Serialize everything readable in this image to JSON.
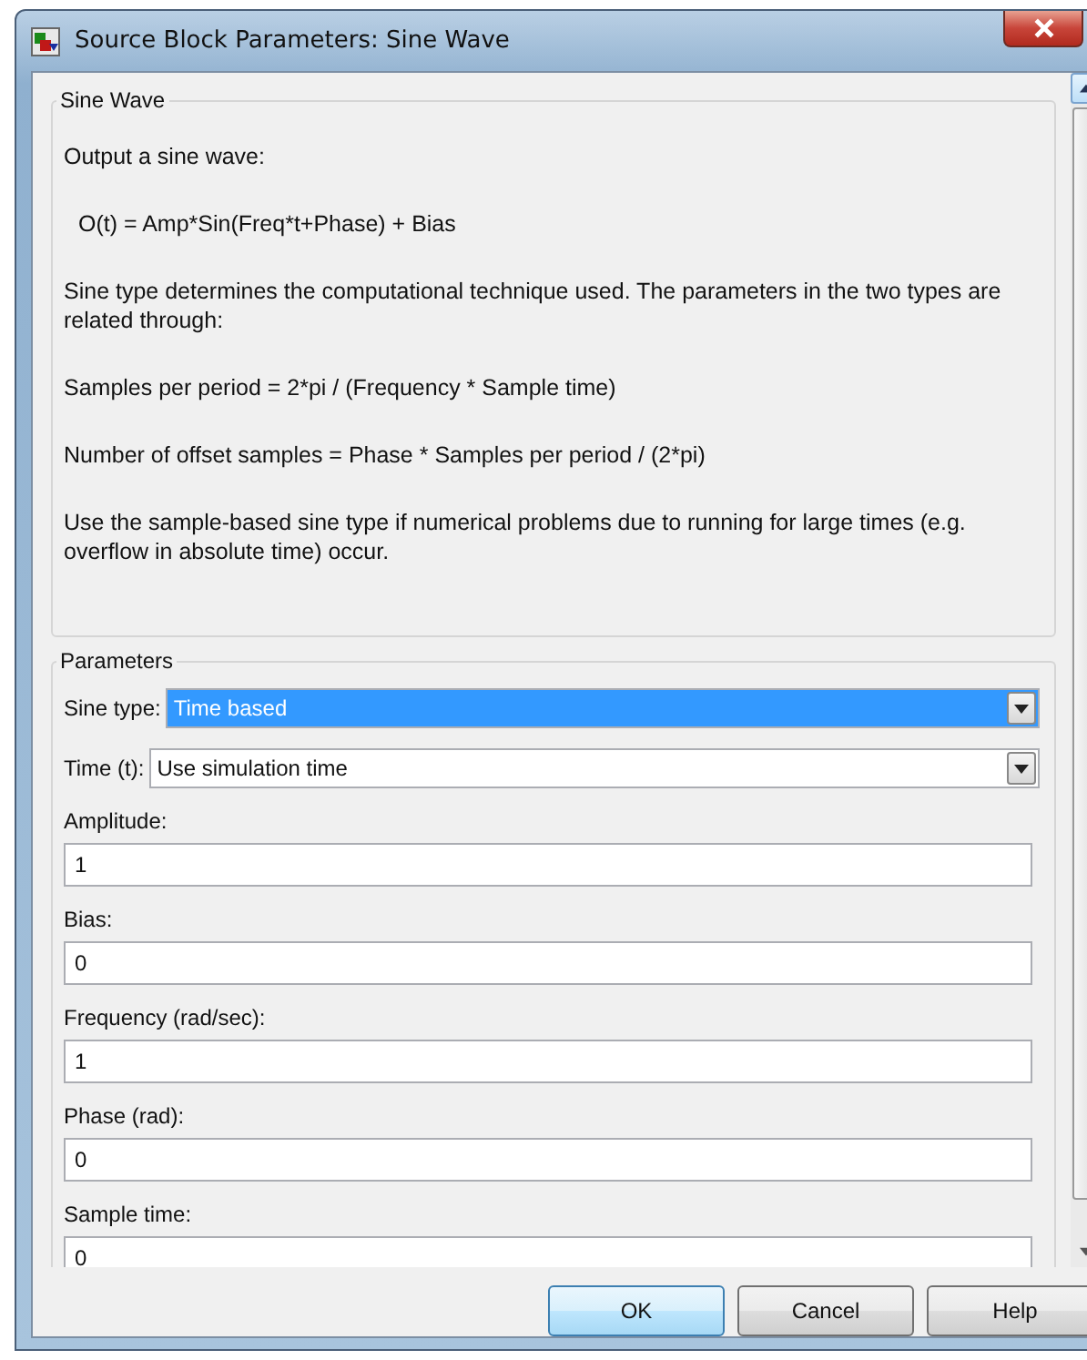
{
  "window": {
    "title": "Source Block Parameters: Sine Wave"
  },
  "description": {
    "heading": "Sine Wave",
    "paragraphs": [
      {
        "text": "Output a sine wave:",
        "kind": "plain"
      },
      {
        "text": "O(t) = Amp*Sin(Freq*t+Phase) + Bias",
        "kind": "formula"
      },
      {
        "text": "Sine type determines the computational technique used. The parameters in the two types are related through:",
        "kind": "plain"
      },
      {
        "text": "Samples per period = 2*pi / (Frequency * Sample time)",
        "kind": "plain"
      },
      {
        "text": "Number of offset samples = Phase * Samples per period / (2*pi)",
        "kind": "plain"
      },
      {
        "text": "Use the sample-based sine type if numerical problems due to running for large times (e.g. overflow in absolute time) occur.",
        "kind": "plain"
      }
    ]
  },
  "parameters": {
    "heading": "Parameters",
    "fields": [
      {
        "kind": "dropdown",
        "label": "Sine type:",
        "value": "Time based",
        "focused": true
      },
      {
        "kind": "dropdown",
        "label": "Time (t):",
        "value": "Use simulation time",
        "focused": false
      },
      {
        "kind": "text",
        "label": "Amplitude:",
        "value": "1"
      },
      {
        "kind": "text",
        "label": "Bias:",
        "value": "0"
      },
      {
        "kind": "text",
        "label": "Frequency (rad/sec):",
        "value": "1"
      },
      {
        "kind": "text",
        "label": "Phase (rad):",
        "value": "0"
      },
      {
        "kind": "text",
        "label": "Sample time:",
        "value": "0"
      }
    ]
  },
  "buttons": [
    {
      "label": "OK",
      "default": true
    },
    {
      "label": "Cancel",
      "default": false
    },
    {
      "label": "Help",
      "default": false
    }
  ]
}
